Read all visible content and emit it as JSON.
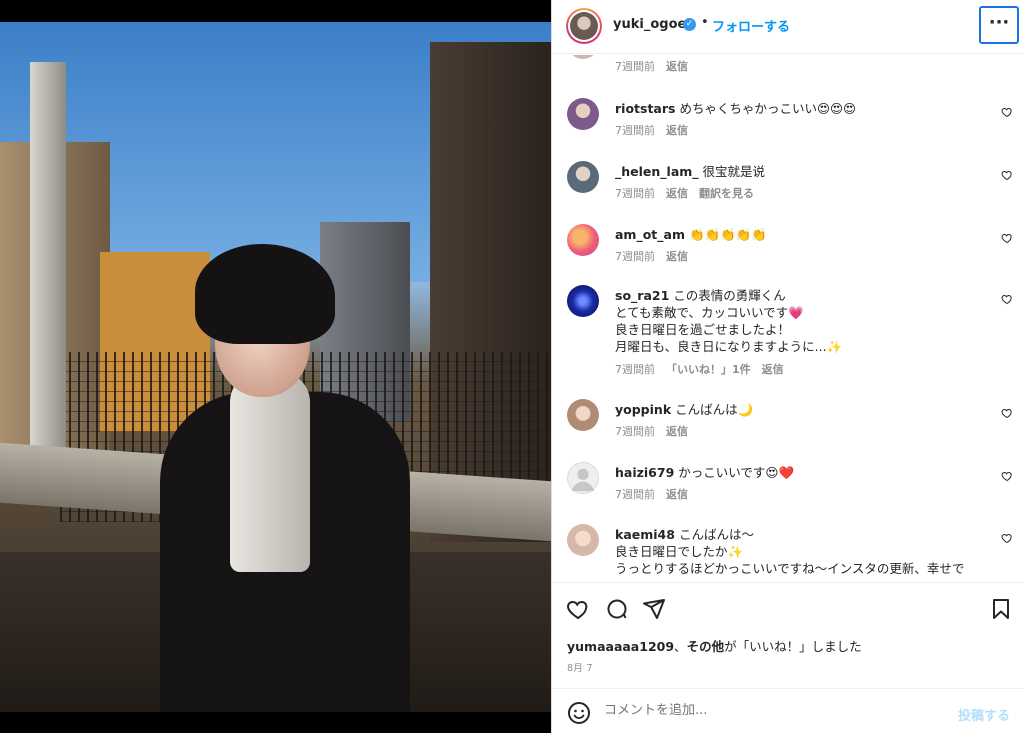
{
  "header": {
    "username": "yuki_ogoe",
    "separator": "•",
    "follow_label": "フォローする",
    "more_label": "···"
  },
  "comments": [
    {
      "user": "",
      "text": "",
      "meta": [
        "7週間前",
        "返信"
      ],
      "avatar_color": "#c9b9b2"
    },
    {
      "user": "riotstars",
      "text": "めちゃくちゃかっこいい😍😍😍",
      "meta": [
        "7週間前",
        "返信"
      ],
      "avatar_color": "#7d5a8a"
    },
    {
      "user": "_helen_lam_",
      "text": "很宝就是说",
      "meta": [
        "7週間前",
        "返信",
        "翻訳を見る"
      ],
      "avatar_color": "#5a6a78"
    },
    {
      "user": "am_ot_am",
      "text": "👏👏👏👏👏",
      "meta": [
        "7週間前",
        "返信"
      ],
      "avatar_color": "#ee5c7c"
    },
    {
      "user": "so_ra21",
      "text": "この表情の勇輝くん\nとても素敵で、カッコいいです💗\n良き日曜日を過ごせましたよ！\n月曜日も、良き日になりますように...✨",
      "meta": [
        "7週間前",
        "「いいね！」1件",
        "返信"
      ],
      "avatar_color": "#1a2aa8"
    },
    {
      "user": "yoppink",
      "text": "こんばんは🌙",
      "meta": [
        "7週間前",
        "返信"
      ],
      "avatar_color": "#b08c74"
    },
    {
      "user": "haizi679",
      "text": "かっこいいです😍❤️",
      "meta": [
        "7週間前",
        "返信"
      ],
      "avatar_color": "#dbdbdb"
    },
    {
      "user": "kaemi48",
      "text": "こんばんは〜\n良き日曜日でしたか✨\nうっとりするほどかっこいいですね〜インスタの更新、幸せで",
      "meta": [],
      "avatar_color": "#d6b8a8"
    }
  ],
  "likes": {
    "user": "yumaaaaa1209",
    "rest_bold": "その他",
    "rest": "が「いいね！」しました",
    "separator": "、"
  },
  "date": "8月 7",
  "add_comment": {
    "placeholder": "コメントを追加...",
    "post_label": "投稿する"
  },
  "colors": {
    "accent": "#0095f6",
    "post_disabled": "#b2dffc",
    "verified": "#3897f0"
  }
}
